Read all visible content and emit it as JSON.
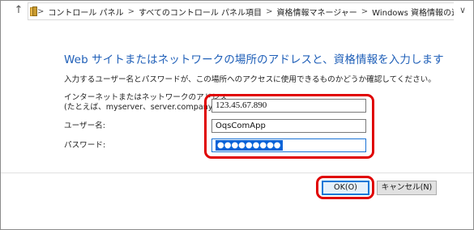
{
  "addressbar": {
    "up_icon": "up-arrow-icon",
    "folder_icon": "control-panel-folder-icon",
    "separator": ">",
    "crumbs": [
      "コントロール パネル",
      "すべてのコントロール パネル項目",
      "資格情報マネージャー",
      "Windows 資格情報の追加"
    ],
    "refresh_icon": "refresh-icon"
  },
  "main": {
    "heading": "Web サイトまたはネットワークの場所のアドレスと、資格情報を入力します",
    "subtext": "入力するユーザー名とパスワードが、この場所へのアクセスに使用できるものかどうか確認してください。",
    "address_label_line1": "インターネットまたはネットワークのアドレス",
    "address_label_line2": "(たとえば、myserver、server.company.com):",
    "address_value": "123.45.67.890",
    "username_label": "ユーザー名:",
    "username_value": "OqsComApp",
    "password_label": "パスワード:",
    "password_value": "●●●●●●●●●"
  },
  "buttons": {
    "ok_label": "OK(O)",
    "cancel_label": "キャンセル(N)"
  },
  "colors": {
    "heading": "#1f5fb8",
    "highlight": "#e00000",
    "selection": "#0a64d8"
  }
}
